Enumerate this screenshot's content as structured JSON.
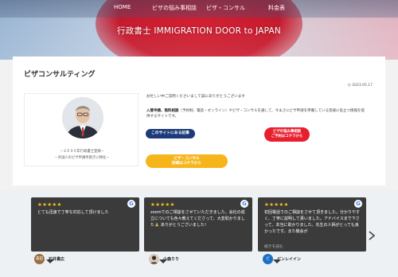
{
  "nav": {
    "items": [
      {
        "label": "HOME"
      },
      {
        "label": "ビザの悩み事相談"
      },
      {
        "label": "ビザ・コンサル"
      },
      {
        "label": "料金表"
      }
    ]
  },
  "hero": {
    "title": "行政書士 IMMIGRATION DOOR to JAPAN"
  },
  "page": {
    "title": "ビザコンサルティング",
    "date": "2023.05.17",
    "intro": "お忙しい中ご訪問くださいまして誠にありがとうございます",
    "body_bold": "入管申請、無料相談",
    "body_rest": "（予約制、電話・オンライン）やビザ・コンサルを通して、今まさにビザ申請を準備している皆様に役立つ情報を提供するサイトです。",
    "profile": {
      "caption1": "－２００６年行政書士登録－",
      "caption2": "－外国人のビザ申請手続きに特化－"
    },
    "buttons": {
      "about": "このサイトにある記事",
      "consult_line1": "ビザの悩み事相談",
      "consult_line2": "ご予約はコチラから",
      "visa_line1": "ビザ・コンサル",
      "visa_line2": "詳細はコチラから"
    }
  },
  "reviews": {
    "star_text": "★★★★★",
    "google_mark": "G",
    "items": [
      {
        "text": "とても迅速で丁寧な対応して頂けました",
        "more": "",
        "user": "石井貴広",
        "avatar_text": "貴田"
      },
      {
        "text": "zoomでのご相談をさせていただきました。会社の成立についても色々教えてくださって、大変助かりました🙏 ありがとうございました！",
        "more": "",
        "user": "小森りり",
        "avatar_text": ""
      },
      {
        "text": "初回電話でのご相談をさせて頂きました。分かりやすく、丁寧に説明して貰いました。アドバイスまで下さって、本当に助かりました。先生の人柄がとっても良かったです。また機会が",
        "more": "続きを読む",
        "user": "ピンレイイン",
        "avatar_text": "ピ"
      }
    ]
  },
  "colors": {
    "navy_button": "#1d3b7a",
    "red_button": "#e8202e",
    "yellow_button": "#f7b51c",
    "review_card": "#3b3b3b",
    "star": "#f6c21c"
  },
  "icons": {
    "date": "clock-icon",
    "google": "google-icon",
    "next": "chevron-right-icon"
  }
}
